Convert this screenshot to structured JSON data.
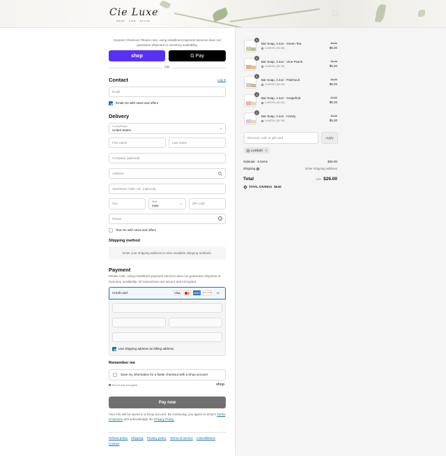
{
  "brand": {
    "logo": "Cie Luxe",
    "tagline": "SOAP · LIFE · STYLE"
  },
  "express": {
    "note": "Express Checkout: Please note, using installment payment services does not guarantee shipment or inventory availability.",
    "shop_label": "shop",
    "gpay_label": "G Pay",
    "or_label": "OR"
  },
  "contact": {
    "heading": "Contact",
    "login_link": "Log in",
    "email_placeholder": "Email",
    "news_label": "Email me with news and offers",
    "news_checked": true
  },
  "delivery": {
    "heading": "Delivery",
    "country_label": "Country/Region",
    "country_value": "United States",
    "first_name": "First name",
    "last_name": "Last name",
    "company": "Company (optional)",
    "address": "Address",
    "apartment": "Apartment, suite, etc. (optional)",
    "city": "City",
    "state_label": "State",
    "state_value": "Iowa",
    "zip": "ZIP code",
    "phone": "Phone",
    "text_label": "Text me with news and offers"
  },
  "shipping": {
    "heading": "Shipping method",
    "note": "Enter your shipping address to view available shipping methods."
  },
  "payment": {
    "heading": "Payment",
    "note": "Please note, using installment payment services does not guarantee shipment or inventory availability. All transactions are secure and encrypted.",
    "credit_card": "Credit card",
    "brands": [
      "VISA",
      "MC",
      "AMEX",
      "DISCOVER"
    ],
    "more": "+4",
    "billing_label": "Use shipping address as billing address",
    "billing_checked": true
  },
  "remember": {
    "heading": "Remember me",
    "save_label": "Save my information for a faster checkout with a Shop account",
    "secure": "Secure and encrypted",
    "shop_word": "shop"
  },
  "pay_now": "Pay now",
  "legal": {
    "text": "Your info will be saved to a Shop account. By continuing, you agree to Shop's",
    "terms": "Terms of Service",
    "and": "and acknowledge the",
    "privacy": "Privacy Policy."
  },
  "footer_links": [
    "Refund policy",
    "Shipping",
    "Privacy policy",
    "Terms of service",
    "Cancellations",
    "Contact"
  ],
  "cart": {
    "items": [
      {
        "qty": "1",
        "name": "Bar Soap, 4.4oz - Green Tea",
        "discount": "LUXE20 (-$1.30)",
        "old_price": "$6.50",
        "price": "$5.20",
        "colors": [
          "#c9cf9f",
          "#b8c493"
        ]
      },
      {
        "qty": "1",
        "name": "Bar Soap, 4.4oz - Vine Peach",
        "discount": "LUXE20 (-$1.30)",
        "old_price": "$6.50",
        "price": "$5.20",
        "colors": [
          "#e8b27a",
          "#d9c59c"
        ]
      },
      {
        "qty": "1",
        "name": "Bar Soap, 4.4oz - Patchouli",
        "discount": "LUXE20 (-$1.30)",
        "old_price": "$6.50",
        "price": "$5.20",
        "colors": [
          "#d8c9b4",
          "#c9b79c"
        ]
      },
      {
        "qty": "1",
        "name": "Bar Soap, 4.4oz - Grapefruit",
        "discount": "LUXE20 (-$1.30)",
        "old_price": "$6.50",
        "price": "$5.20",
        "colors": [
          "#f0b3ad",
          "#e8d3c5"
        ]
      },
      {
        "qty": "1",
        "name": "Bar Soap, 4.4oz - Honey",
        "discount": "LUXE20 (-$1.30)",
        "old_price": "$6.50",
        "price": "$5.20",
        "colors": [
          "#e0c6dc",
          "#e7d9a8"
        ]
      }
    ],
    "discount_placeholder": "Discount code or gift card",
    "apply_label": "Apply",
    "code_chip": "LUXE20",
    "subtotal_label": "Subtotal · 5 items",
    "subtotal_value": "$26.00",
    "shipping_label": "Shipping",
    "shipping_value": "Enter shipping address",
    "total_label": "Total",
    "currency": "USD",
    "total_value": "$26.00",
    "savings_label": "TOTAL SAVINGS",
    "savings_value": "$6.50"
  }
}
